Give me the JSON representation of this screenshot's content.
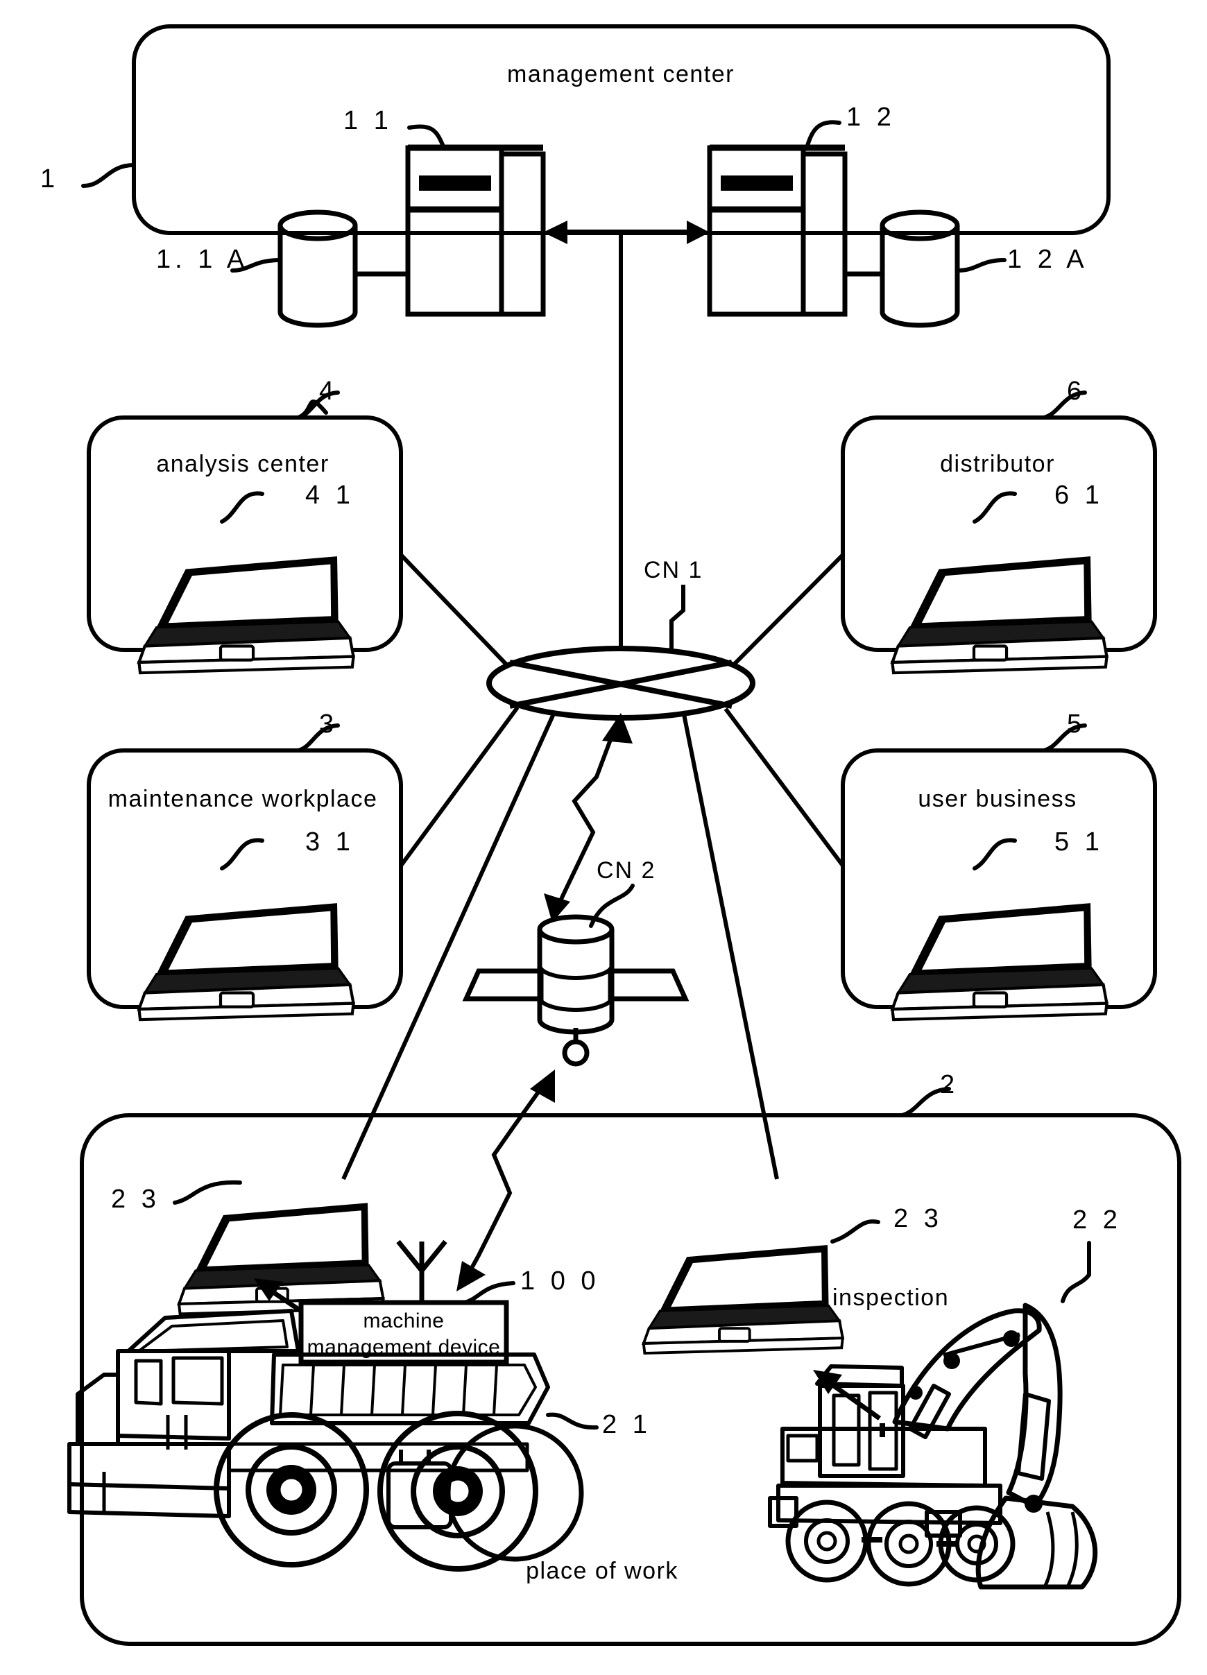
{
  "figure": {
    "type": "patent-system-diagram",
    "description": "Machine management system network diagram"
  },
  "nodes": {
    "management_center": {
      "title": "management center",
      "ref": "1"
    },
    "analysis_center": {
      "title": "analysis center",
      "ref": "4"
    },
    "maintenance_workplace": {
      "title": "maintenance workplace",
      "ref": "3"
    },
    "distributor": {
      "title": "distributor",
      "ref": "6"
    },
    "user_business": {
      "title": "user business",
      "ref": "5"
    },
    "place_of_work": {
      "title": "place of work",
      "ref": "2"
    }
  },
  "servers": {
    "server_left_ref": "1 1",
    "server_right_ref": "1 2",
    "db_left_ref": "1. 1 A",
    "db_right_ref": "1 2 A"
  },
  "computers": {
    "analysis_center_pc_ref": "4 1",
    "maintenance_pc_ref": "3 1",
    "distributor_pc_ref": "6 1",
    "user_business_pc_ref": "5 1",
    "work_pc_left_ref": "2 3",
    "work_pc_right_ref": "2 3"
  },
  "networks": {
    "cn1_label": "CN 1",
    "cn2_label": "CN 2"
  },
  "worksite": {
    "machine_management_device": "machine\nmanagement device",
    "machine_management_device_line1": "machine",
    "machine_management_device_line2": "management device",
    "machine_management_device_ref": "1 0 0",
    "dump_truck_ref": "2 1",
    "excavator_ref": "2 2",
    "inspection_label": "inspection"
  },
  "colors": {
    "line": "#000000",
    "background": "#ffffff"
  }
}
